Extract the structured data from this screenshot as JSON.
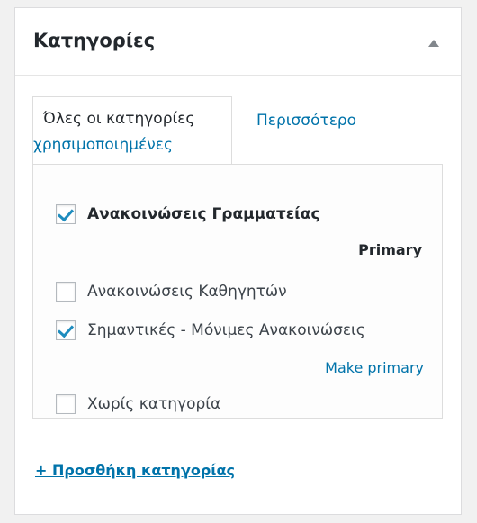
{
  "panel": {
    "title": "Κατηγορίες",
    "toggle_icon": "triangle-up-icon"
  },
  "tabs": {
    "all_label": "Όλες οι κατηγορίες",
    "most_used_label": "Περισσότερο χρησιμοποιημένες"
  },
  "categories": [
    {
      "label": "Ανακοινώσεις Γραμματείας",
      "checked": true,
      "primary": true
    },
    {
      "label": "Ανακοινώσεις Καθηγητών",
      "checked": false
    },
    {
      "label": "Σημαντικές - Μόνιμες Ανακοινώσεις",
      "checked": true,
      "primary": false
    },
    {
      "label": "Χωρίς κατηγορία",
      "checked": false
    }
  ],
  "primary_label": "Primary",
  "make_primary_label": "Make primary",
  "add_category_label": "+ Προσθήκη κατηγορίας",
  "colors": {
    "link": "#0073aa",
    "check": "#1e8cbe"
  }
}
